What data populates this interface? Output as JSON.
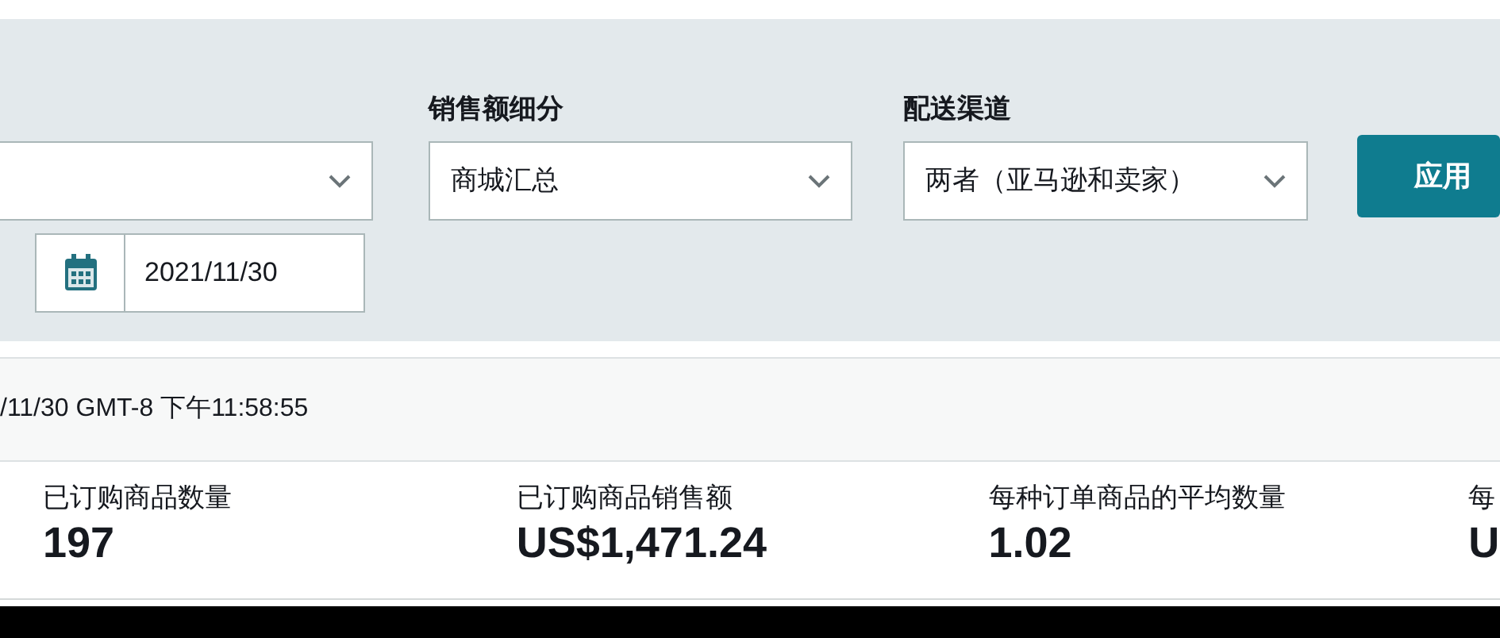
{
  "filters": [
    {
      "label": "销售额细分",
      "value": "商城汇总"
    },
    {
      "label": "配送渠道",
      "value": "两者（亚马逊和卖家）"
    }
  ],
  "apply_button": "应用",
  "date_field": {
    "value": "2021/11/30"
  },
  "timestamp": "/11/30 GMT-8 下午11:58:55",
  "metrics": [
    {
      "label": "已订购商品数量",
      "value": "197"
    },
    {
      "label": "已订购商品销售额",
      "value": "US$1,471.24"
    },
    {
      "label": "每种订单商品的平均数量",
      "value": "1.02"
    },
    {
      "label": "每",
      "value": "U"
    }
  ]
}
